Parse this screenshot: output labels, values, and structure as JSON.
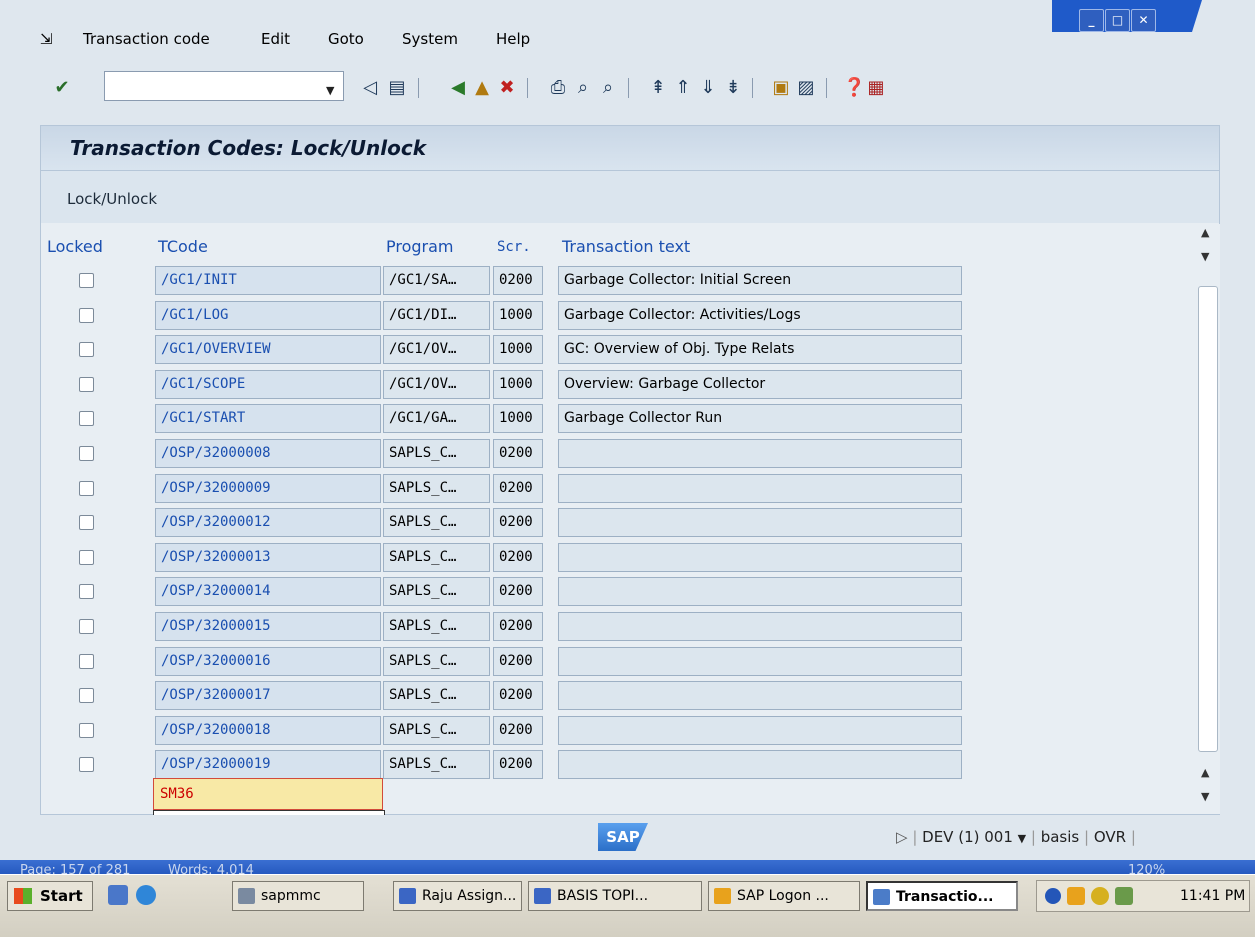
{
  "menubar": {
    "items": [
      "Transaction code",
      "Edit",
      "Goto",
      "System",
      "Help"
    ],
    "window_controls": [
      "minimize",
      "maximize",
      "close"
    ]
  },
  "toolbar": {
    "command_field_value": "",
    "icons": [
      "enter-icon",
      "back-icon",
      "save-icon",
      "back-green-icon",
      "exit-icon",
      "cancel-icon",
      "print-icon",
      "find-icon",
      "find-next-icon",
      "first-page-icon",
      "previous-page-icon",
      "next-page-icon",
      "last-page-icon",
      "new-session-icon",
      "shortcut-icon",
      "help-icon",
      "layout-icon"
    ]
  },
  "screen": {
    "title": "Transaction Codes: Lock/Unlock",
    "app_toolbar_button": "Lock/Unlock"
  },
  "table": {
    "columns": [
      "Locked",
      "TCode",
      "Program",
      "Scr.",
      "Transaction text"
    ],
    "rows": [
      {
        "locked": false,
        "tcode": "/GC1/INIT",
        "program": "/GC1/SA…",
        "screen": "0200",
        "text": "Garbage Collector: Initial Screen"
      },
      {
        "locked": false,
        "tcode": "/GC1/LOG",
        "program": "/GC1/DI…",
        "screen": "1000",
        "text": "Garbage Collector: Activities/Logs"
      },
      {
        "locked": false,
        "tcode": "/GC1/OVERVIEW",
        "program": "/GC1/OV…",
        "screen": "1000",
        "text": "GC: Overview of Obj. Type Relats"
      },
      {
        "locked": false,
        "tcode": "/GC1/SCOPE",
        "program": "/GC1/OV…",
        "screen": "1000",
        "text": "Overview: Garbage Collector"
      },
      {
        "locked": false,
        "tcode": "/GC1/START",
        "program": "/GC1/GA…",
        "screen": "1000",
        "text": "Garbage Collector Run"
      },
      {
        "locked": false,
        "tcode": "/OSP/32000008",
        "program": "SAPLS_C…",
        "screen": "0200",
        "text": ""
      },
      {
        "locked": false,
        "tcode": "/OSP/32000009",
        "program": "SAPLS_C…",
        "screen": "0200",
        "text": ""
      },
      {
        "locked": false,
        "tcode": "/OSP/32000012",
        "program": "SAPLS_C…",
        "screen": "0200",
        "text": ""
      },
      {
        "locked": false,
        "tcode": "/OSP/32000013",
        "program": "SAPLS_C…",
        "screen": "0200",
        "text": ""
      },
      {
        "locked": false,
        "tcode": "/OSP/32000014",
        "program": "SAPLS_C…",
        "screen": "0200",
        "text": ""
      },
      {
        "locked": false,
        "tcode": "/OSP/32000015",
        "program": "SAPLS_C…",
        "screen": "0200",
        "text": ""
      },
      {
        "locked": false,
        "tcode": "/OSP/32000016",
        "program": "SAPLS_C…",
        "screen": "0200",
        "text": ""
      },
      {
        "locked": false,
        "tcode": "/OSP/32000017",
        "program": "SAPLS_C…",
        "screen": "0200",
        "text": ""
      },
      {
        "locked": false,
        "tcode": "/OSP/32000018",
        "program": "SAPLS_C…",
        "screen": "0200",
        "text": ""
      },
      {
        "locked": false,
        "tcode": "/OSP/32000019",
        "program": "SAPLS_C…",
        "screen": "0200",
        "text": ""
      }
    ],
    "input_value": "SM36"
  },
  "statusbar": {
    "logo": "SAP",
    "system": "DEV (1) 001",
    "user": "basis",
    "mode": "OVR"
  },
  "wordbar": {
    "page": "Page: 157 of 281",
    "words": "Words: 4,014",
    "zoom": "120%"
  },
  "taskbar": {
    "start": "Start",
    "tasks": [
      "sapmmc",
      "Raju Assign...",
      "BASIS TOPI...",
      "SAP Logon ...",
      "Transactio..."
    ],
    "active_task": "Transactio...",
    "clock": "11:41 PM"
  },
  "colors": {
    "header_blue": "#1a4fb0",
    "input_red": "#c00000",
    "input_bg": "#f8e9a6"
  }
}
